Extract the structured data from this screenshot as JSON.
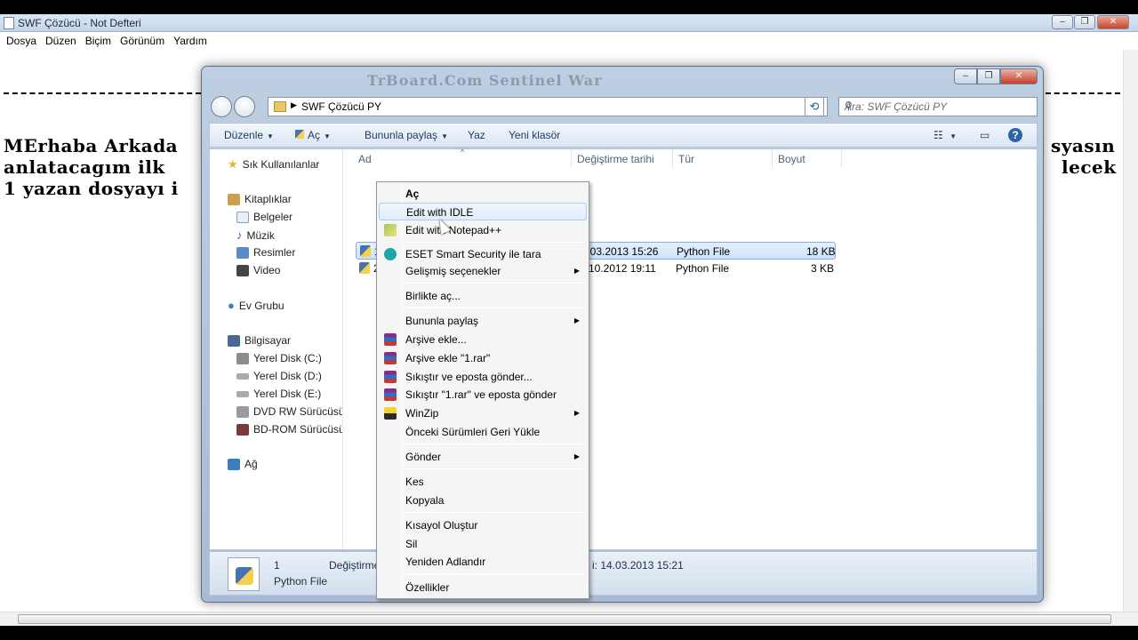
{
  "notepad": {
    "title": "SWF Çözücü - Not Defteri",
    "menu": [
      "Dosya",
      "Düzen",
      "Biçim",
      "Görünüm",
      "Yardım"
    ],
    "lines": [
      "MErhaba Arkada",
      "anlatacagım ilk",
      "1 yazan dosyayı i"
    ],
    "right_lines": [
      "syasın",
      "lecek"
    ],
    "header_text": "TrBoard.Com Sentinel War"
  },
  "explorer": {
    "address": "SWF Çözücü PY",
    "search_placeholder": "Ara: SWF Çözücü PY",
    "toolbar": {
      "organize": "Düzenle",
      "open": "Aç",
      "share": "Bununla paylaş",
      "burn": "Yaz",
      "new_folder": "Yeni klasör"
    },
    "nav": {
      "favorites": "Sık Kullanılanlar",
      "libraries": "Kitaplıklar",
      "lib_items": [
        "Belgeler",
        "Müzik",
        "Resimler",
        "Video"
      ],
      "homegroup": "Ev Grubu",
      "computer": "Bilgisayar",
      "drives": [
        "Yerel Disk (C:)",
        "Yerel Disk (D:)",
        "Yerel Disk (E:)",
        "DVD RW Sürücüsü (F",
        "BD-ROM Sürücüsü ("
      ],
      "network": "Ağ"
    },
    "columns": {
      "name": "Ad",
      "date": "Değiştirme tarihi",
      "type": "Tür",
      "size": "Boyut"
    },
    "files": [
      {
        "name": "1",
        "date": "14.03.2013 15:26",
        "type": "Python File",
        "size": "18 KB"
      },
      {
        "name": "2",
        "date": "10.2012 19:11",
        "type": "Python File",
        "size": "3 KB"
      }
    ],
    "details": {
      "name": "1",
      "type": "Python File",
      "modified_label": "Değiştirme",
      "created": "i: 14.03.2013 15:21"
    }
  },
  "context_menu": {
    "items": [
      {
        "label": "Aç",
        "bold": true
      },
      {
        "label": "Edit with IDLE",
        "hover": true
      },
      {
        "label": "Edit with Notepad++",
        "icon": "notepadpp-icon"
      },
      {
        "label": "ESET Smart Security ile tara",
        "icon": "eset-icon"
      },
      {
        "label": "Gelişmiş seçenekler",
        "submenu": true
      },
      {
        "label": "Birlikte aç..."
      },
      {
        "label": "Bununla paylaş",
        "submenu": true
      },
      {
        "label": "Arşive ekle...",
        "icon": "winrar-icon"
      },
      {
        "label": "Arşive ekle \"1.rar\"",
        "icon": "winrar-icon"
      },
      {
        "label": "Sıkıştır ve eposta gönder...",
        "icon": "winrar-icon"
      },
      {
        "label": "Sıkıştır \"1.rar\" ve eposta gönder",
        "icon": "winrar-icon"
      },
      {
        "label": "WinZip",
        "icon": "winzip-icon",
        "submenu": true
      },
      {
        "label": "Önceki Sürümleri Geri Yükle"
      },
      {
        "label": "Gönder",
        "submenu": true
      },
      {
        "label": "Kes"
      },
      {
        "label": "Kopyala"
      },
      {
        "label": "Kısayol Oluştur"
      },
      {
        "label": "Sil"
      },
      {
        "label": "Yeniden Adlandır"
      },
      {
        "label": "Özellikler"
      }
    ],
    "submenu_arrow": "▶"
  }
}
